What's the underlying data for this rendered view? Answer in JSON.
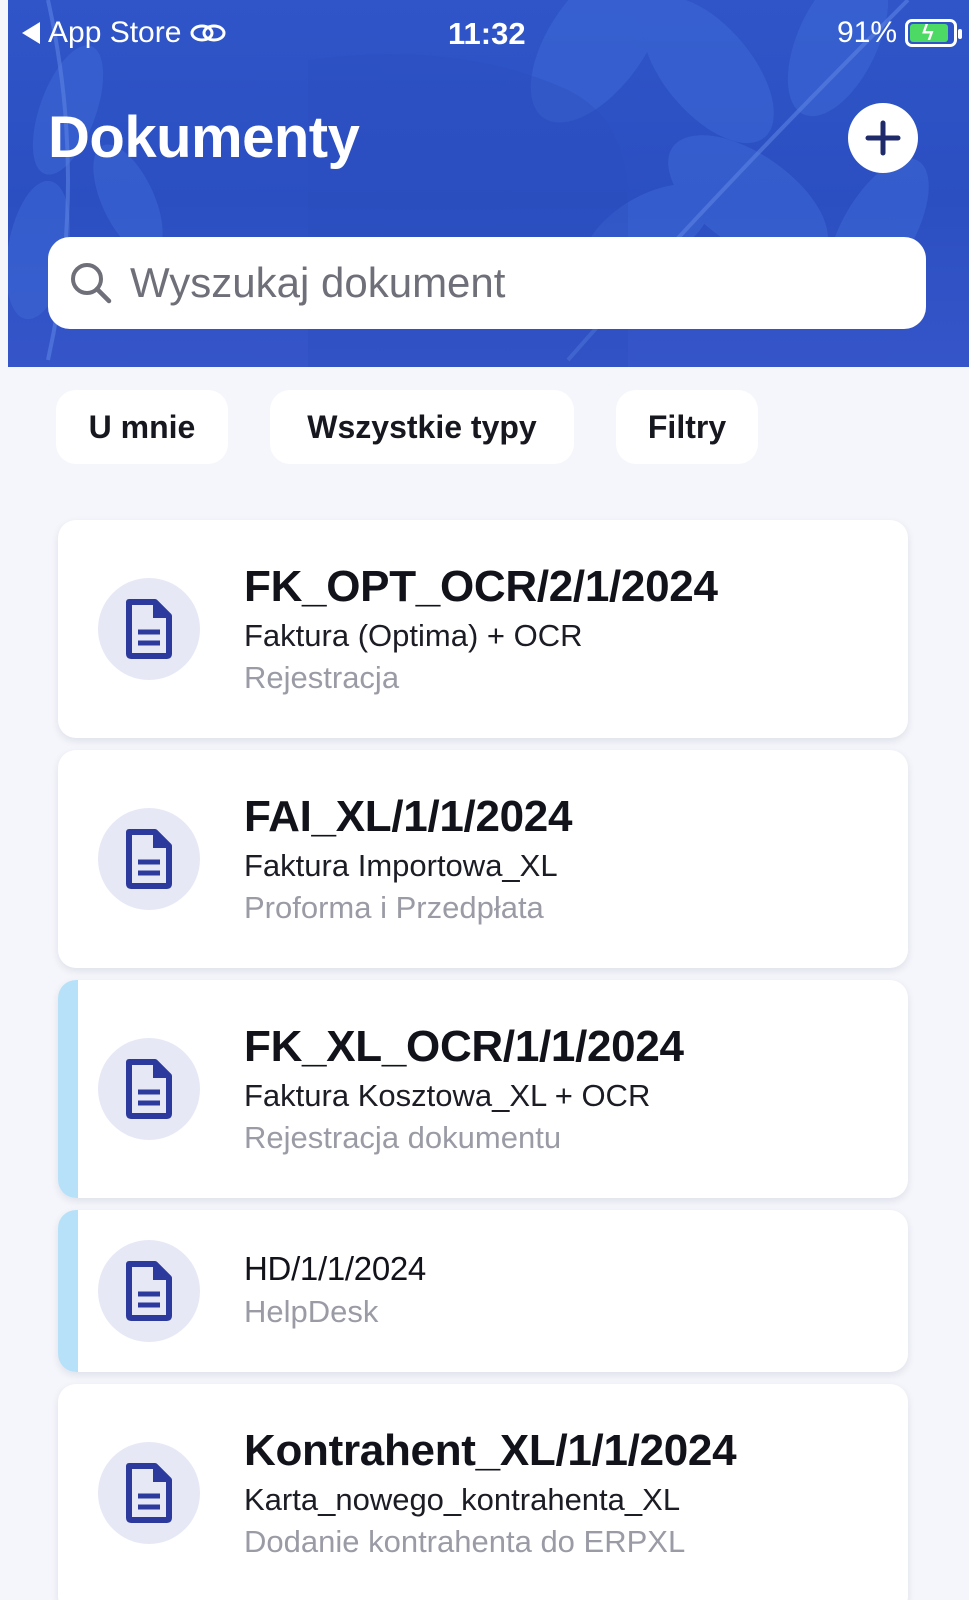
{
  "status_bar": {
    "back_label": "App Store",
    "time": "11:32",
    "battery": "91%"
  },
  "header": {
    "title": "Dokumenty",
    "search_placeholder": "Wyszukaj dokument"
  },
  "filters": [
    {
      "label": "U mnie"
    },
    {
      "label": "Wszystkie typy"
    },
    {
      "label": "Filtry"
    }
  ],
  "documents": [
    {
      "title": "FK_OPT_OCR/2/1/2024",
      "type": "Faktura (Optima) + OCR",
      "stage": "Rejestracja",
      "highlighted": false
    },
    {
      "title": "FAI_XL/1/1/2024",
      "type": "Faktura Importowa_XL",
      "stage": "Proforma i Przedpłata",
      "highlighted": false
    },
    {
      "title": "FK_XL_OCR/1/1/2024",
      "type": "Faktura Kosztowa_XL + OCR",
      "stage": "Rejestracja dokumentu",
      "highlighted": true
    },
    {
      "title": "HD/1/1/2024",
      "type": "",
      "stage": "HelpDesk",
      "highlighted": true
    },
    {
      "title": "Kontrahent_XL/1/1/2024",
      "type": "Karta_nowego_kontrahenta_XL",
      "stage": "Dodanie kontrahenta do ERPXL",
      "highlighted": false
    }
  ],
  "colors": {
    "header_blue": "#2f55c8",
    "accent_bar": "#b7e1f8",
    "icon_blue": "#2c3a9e",
    "battery_green": "#4cd964"
  },
  "icons": {
    "back": "back-triangle-icon",
    "link": "link-icon",
    "battery": "battery-charging-icon",
    "add": "plus-icon",
    "search": "search-icon",
    "document": "document-icon"
  }
}
